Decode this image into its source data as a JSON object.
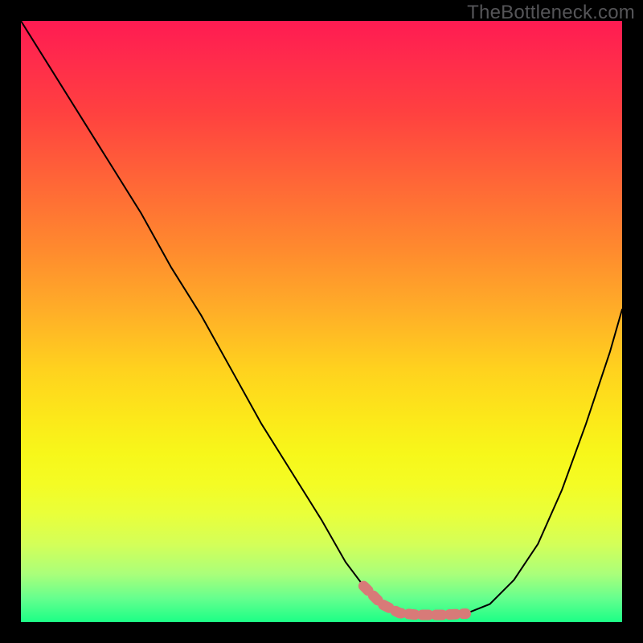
{
  "watermark": "TheBottleneck.com",
  "chart_data": {
    "type": "line",
    "title": "",
    "xlabel": "",
    "ylabel": "",
    "xlim": [
      0,
      100
    ],
    "ylim": [
      0,
      100
    ],
    "series": [
      {
        "name": "bottleneck-curve",
        "x": [
          0,
          5,
          10,
          15,
          20,
          25,
          30,
          35,
          40,
          45,
          50,
          54,
          57,
          60,
          63,
          66,
          70,
          74,
          78,
          82,
          86,
          90,
          94,
          98,
          100
        ],
        "y": [
          100,
          92,
          84,
          76,
          68,
          59,
          51,
          42,
          33,
          25,
          17,
          10,
          6,
          3,
          1.5,
          1.2,
          1.2,
          1.4,
          3,
          7,
          13,
          22,
          33,
          45,
          52
        ]
      }
    ],
    "markers": [
      {
        "name": "optimal-region",
        "xstart": 57,
        "xend": 74,
        "y": 1.5
      }
    ],
    "background": {
      "type": "vertical-gradient",
      "stops": [
        {
          "pos": 0,
          "color": "#ff1b52"
        },
        {
          "pos": 50,
          "color": "#ffc81e"
        },
        {
          "pos": 75,
          "color": "#f7f71a"
        },
        {
          "pos": 100,
          "color": "#1cff86"
        }
      ]
    }
  }
}
